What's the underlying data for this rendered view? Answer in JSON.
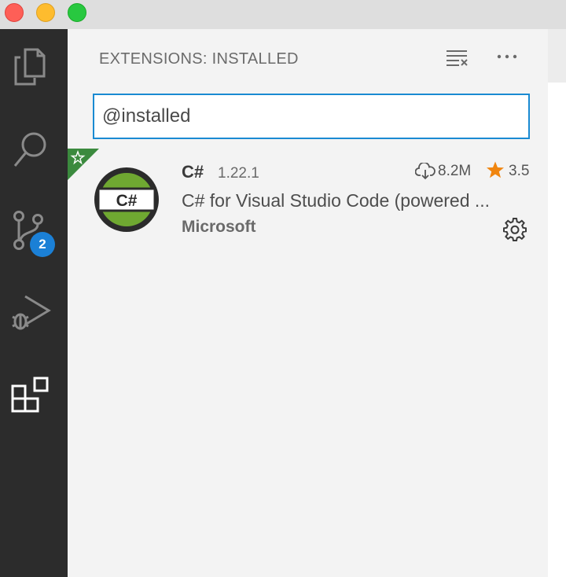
{
  "window": {
    "traffic_lights": [
      "close",
      "minimize",
      "zoom"
    ]
  },
  "activity_bar": {
    "items": [
      {
        "icon": "files-icon"
      },
      {
        "icon": "search-icon"
      },
      {
        "icon": "source-control-icon",
        "badge": "2"
      },
      {
        "icon": "run-debug-icon"
      },
      {
        "icon": "extensions-icon",
        "active": true
      }
    ],
    "background": "#2c2c2c"
  },
  "sidebar": {
    "title": "EXTENSIONS: INSTALLED",
    "actions": [
      "clear-extensions-icon",
      "more-actions-icon"
    ],
    "search": {
      "value": "@installed"
    },
    "extensions": [
      {
        "name": "C#",
        "version": "1.22.1",
        "downloads": "8.2M",
        "rating": "3.5",
        "description": "C# for Visual Studio Code (powered ...",
        "publisher": "Microsoft",
        "logo_text": "C#",
        "recommended_badge": "star"
      }
    ]
  },
  "colors": {
    "accent": "#1a8ad2",
    "badge": "#1b80d6",
    "star": "#f0850f",
    "recommended": "#3b8a3e",
    "logo_green": "#6fa831"
  }
}
